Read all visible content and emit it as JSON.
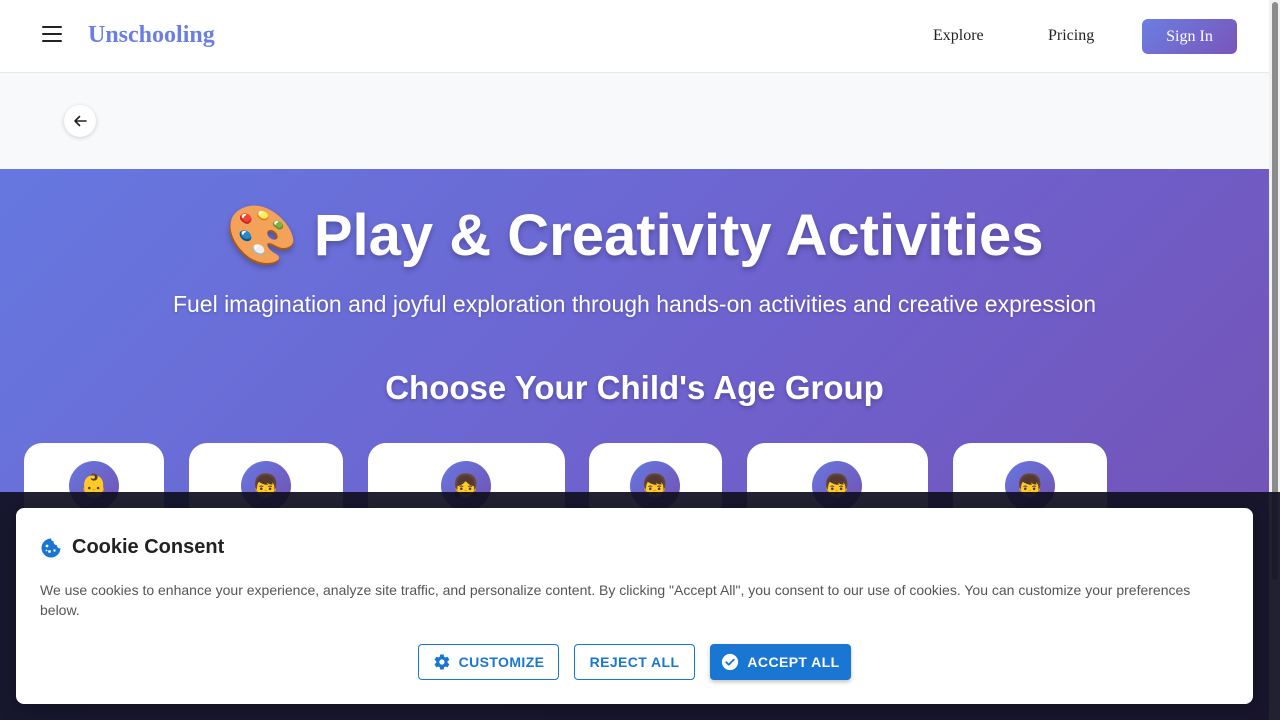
{
  "header": {
    "brand": "Unschooling",
    "nav": [
      {
        "label": "Explore"
      },
      {
        "label": "Pricing"
      }
    ],
    "sign_in_label": "Sign In"
  },
  "hero": {
    "title_emoji": "🎨",
    "title": "Play & Creativity Activities",
    "subtitle": "Fuel imagination and joyful exploration through hands-on activities and creative expression",
    "age_group_title": "Choose Your Child's Age Group",
    "age_cards": [
      {
        "avatar_emoji": "👶"
      },
      {
        "avatar_emoji": "👦"
      },
      {
        "avatar_emoji": "👧"
      },
      {
        "avatar_emoji": "👦"
      },
      {
        "avatar_emoji": "👦"
      },
      {
        "avatar_emoji": "👦"
      }
    ]
  },
  "cookie": {
    "title": "Cookie Consent",
    "text": "We use cookies to enhance your experience, analyze site traffic, and personalize content. By clicking \"Accept All\", you consent to our use of cookies. You can customize your preferences below.",
    "customize_label": "Customize",
    "reject_label": "Reject All",
    "accept_label": "Accept All"
  },
  "colors": {
    "brand": "#6b7ee3",
    "hero_start": "#6678e0",
    "hero_end": "#7450b0",
    "primary_button": "#1976d2"
  },
  "icons": {
    "menu": "hamburger-icon",
    "back": "arrow-left-icon",
    "cookie": "cookie-icon",
    "customize": "gear-icon",
    "accept": "check-circle-icon"
  }
}
